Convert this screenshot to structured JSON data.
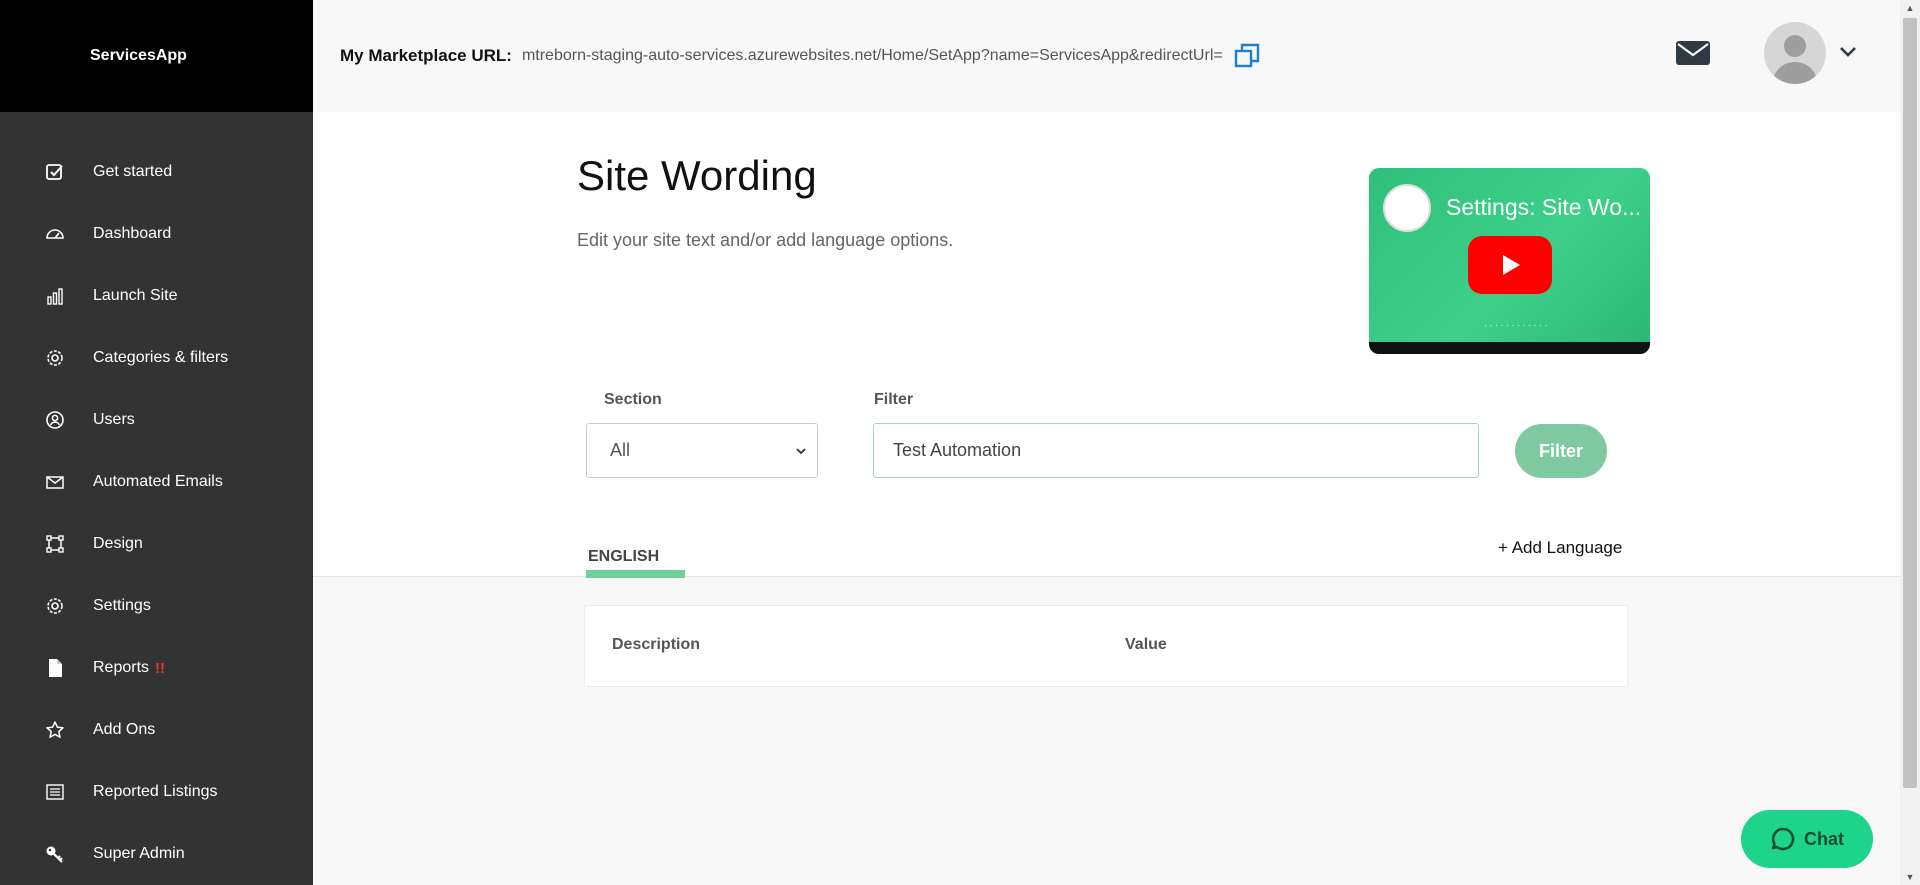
{
  "sidebar": {
    "brand": "ServicesApp",
    "items": [
      {
        "label": "Get started",
        "icon": "checkbox-icon"
      },
      {
        "label": "Dashboard",
        "icon": "speedometer-icon"
      },
      {
        "label": "Launch Site",
        "icon": "bar-chart-icon"
      },
      {
        "label": "Categories & filters",
        "icon": "gear-icon"
      },
      {
        "label": "Users",
        "icon": "user-circle-icon"
      },
      {
        "label": "Automated Emails",
        "icon": "envelope-icon"
      },
      {
        "label": "Design",
        "icon": "crop-icon"
      },
      {
        "label": "Settings",
        "icon": "gear-icon"
      },
      {
        "label": "Reports",
        "icon": "document-icon",
        "badge": "!!"
      },
      {
        "label": "Add Ons",
        "icon": "star-icon"
      },
      {
        "label": "Reported Listings",
        "icon": "list-icon"
      },
      {
        "label": "Super Admin",
        "icon": "key-icon"
      }
    ]
  },
  "header": {
    "marketplace_label": "My Marketplace URL:",
    "marketplace_url": "mtreborn-staging-auto-services.azurewebsites.net/Home/SetApp?name=ServicesApp&redirectUrl="
  },
  "main": {
    "title": "Site Wording",
    "subtitle": "Edit your site text and/or add language options.",
    "video_title": "Settings: Site Wo...",
    "section_label": "Section",
    "section_value": "All",
    "filter_label": "Filter",
    "filter_value": "Test Automation",
    "filter_button": "Filter",
    "tab_english": "ENGLISH",
    "add_language": "+ Add Language",
    "table_headers": [
      "Description",
      "Value"
    ]
  },
  "chat": {
    "label": "Chat"
  },
  "colors": {
    "sidebar_bg": "#333333",
    "brand_bg": "#000000",
    "accent_green": "#6fd19a",
    "filter_button": "#7fc9a1",
    "chat_button": "#1dd48a",
    "copy_icon": "#1e7fd6",
    "badge_red": "#e53935"
  }
}
